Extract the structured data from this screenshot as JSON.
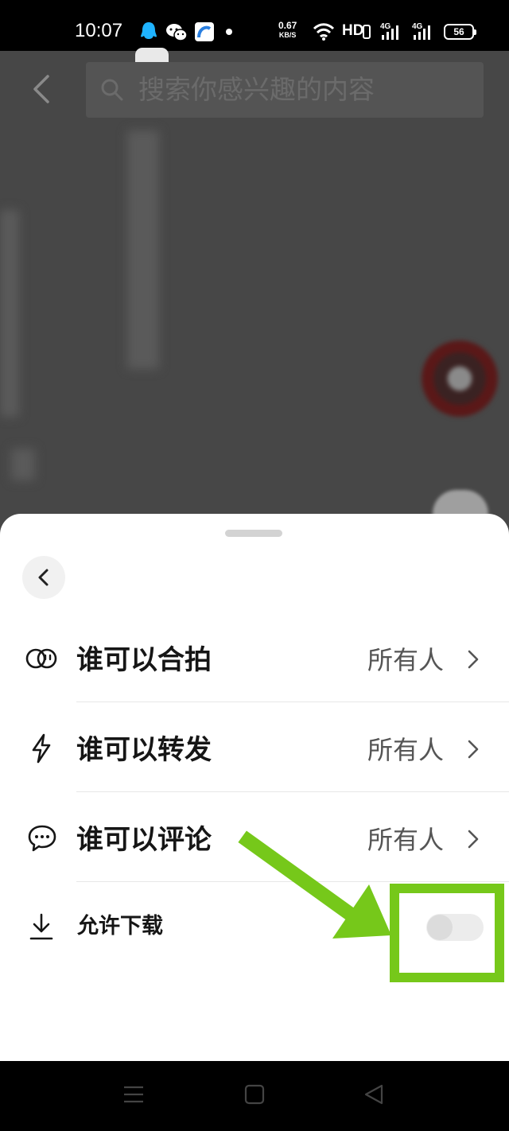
{
  "status_bar": {
    "time": "10:07",
    "net_speed_value": "0.67",
    "net_speed_unit": "KB/S",
    "hd_label": "HD",
    "signal_1_label": "4G",
    "signal_2_label": "4G",
    "battery_level": "56",
    "notification_icons": [
      "qq-icon",
      "wechat-icon",
      "app-icon",
      "dot-icon"
    ]
  },
  "header": {
    "search_placeholder": "搜索你感兴趣的内容"
  },
  "sheet": {
    "rows": [
      {
        "label": "谁可以合拍",
        "value": "所有人",
        "icon": "duet-icon"
      },
      {
        "label": "谁可以转发",
        "value": "所有人",
        "icon": "lightning-icon"
      },
      {
        "label": "谁可以评论",
        "value": "所有人",
        "icon": "comment-icon"
      }
    ],
    "download": {
      "label": "允许下载",
      "icon": "download-icon",
      "enabled": false
    }
  },
  "annotation": {
    "color": "#76c81a",
    "target": "download-toggle"
  },
  "nav_bar": {
    "buttons": [
      "menu-icon",
      "home-icon",
      "back-icon"
    ]
  }
}
